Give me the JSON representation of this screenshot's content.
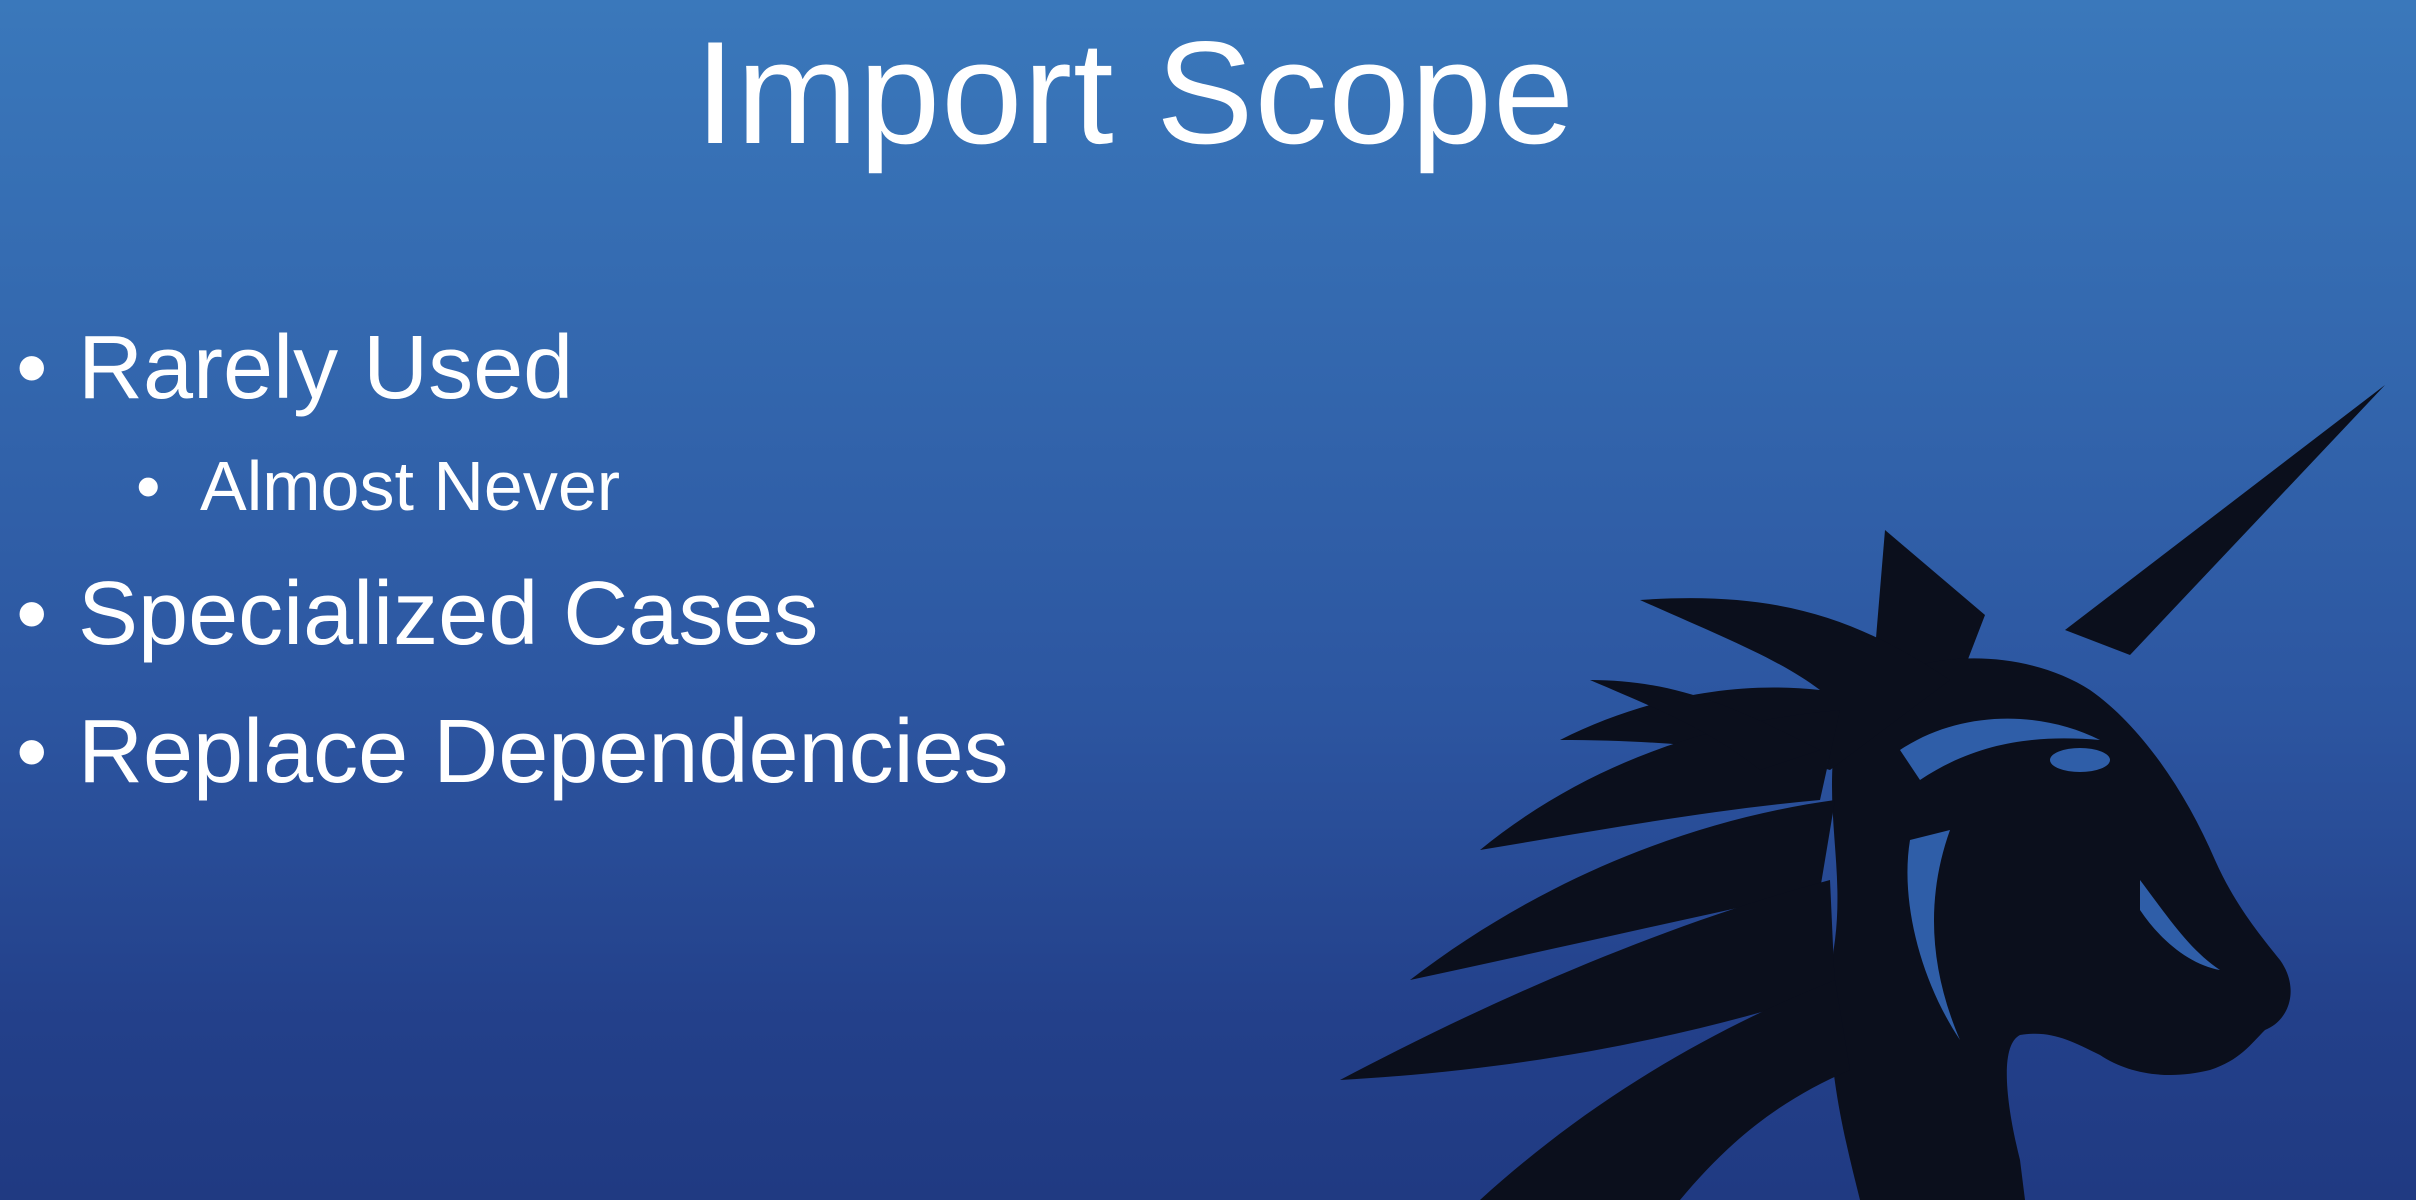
{
  "slide": {
    "title": "Import Scope",
    "bullets": [
      {
        "text": "Rarely Used",
        "sub_bullets": [
          "Almost Never"
        ]
      },
      {
        "text": "Specialized Cases",
        "sub_bullets": []
      },
      {
        "text": "Replace Dependencies",
        "sub_bullets": []
      }
    ],
    "bullet_char": "•",
    "logo_icon": "unicorn-head-icon",
    "colors": {
      "background_top": "#3a78bb",
      "background_bottom": "#203a82",
      "text": "#ffffff",
      "logo": "#0b0f1c"
    }
  }
}
